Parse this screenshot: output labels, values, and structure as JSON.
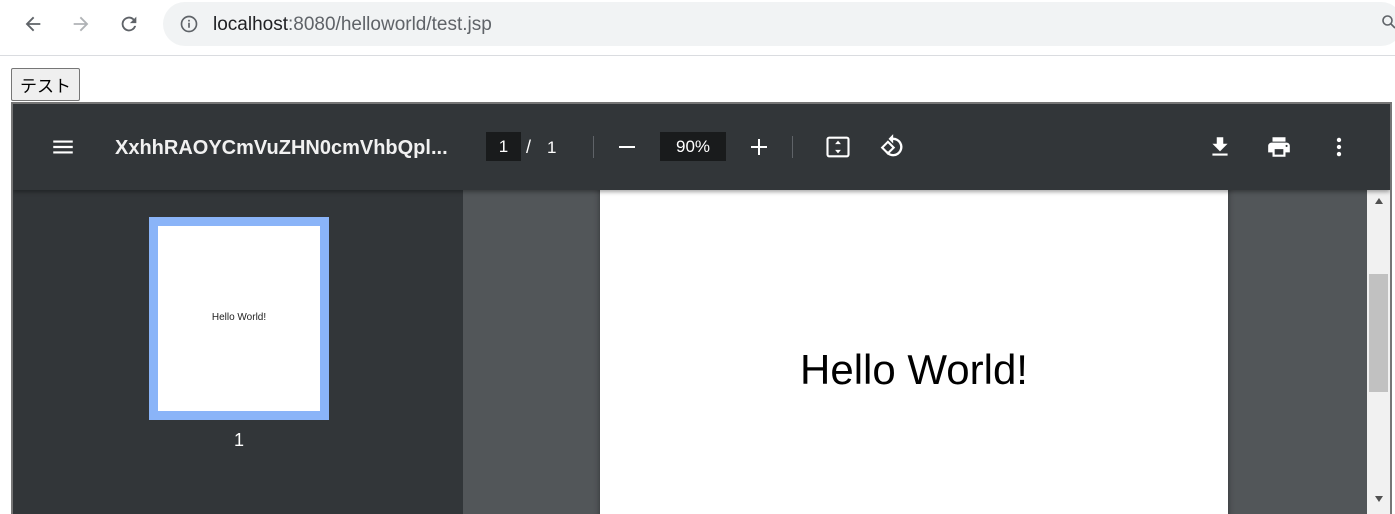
{
  "browser": {
    "back_icon": "arrow-left-icon",
    "forward_icon": "arrow-right-icon",
    "reload_icon": "reload-icon",
    "info_icon": "info-icon",
    "url_host": "localhost",
    "url_rest": ":8080/helloworld/test.jsp"
  },
  "page": {
    "button_label": "テスト"
  },
  "pdf_viewer": {
    "title": "XxhhRAOYCmVuZHN0cmVhbQpl...",
    "current_page": "1",
    "page_separator": "/",
    "total_pages": "1",
    "zoom": "90%",
    "icons": [
      "menu-icon",
      "zoom-out-icon",
      "zoom-in-icon",
      "fit-page-icon",
      "rotate-icon",
      "download-icon",
      "print-icon",
      "more-vert-icon"
    ],
    "thumbnail_text": "Hello World!",
    "thumbnail_label": "1",
    "document_text": "Hello World!"
  },
  "colors": {
    "toolbar_bg": "#323639",
    "viewer_bg": "#525659",
    "thumbnail_highlight": "#8ab4f8"
  }
}
